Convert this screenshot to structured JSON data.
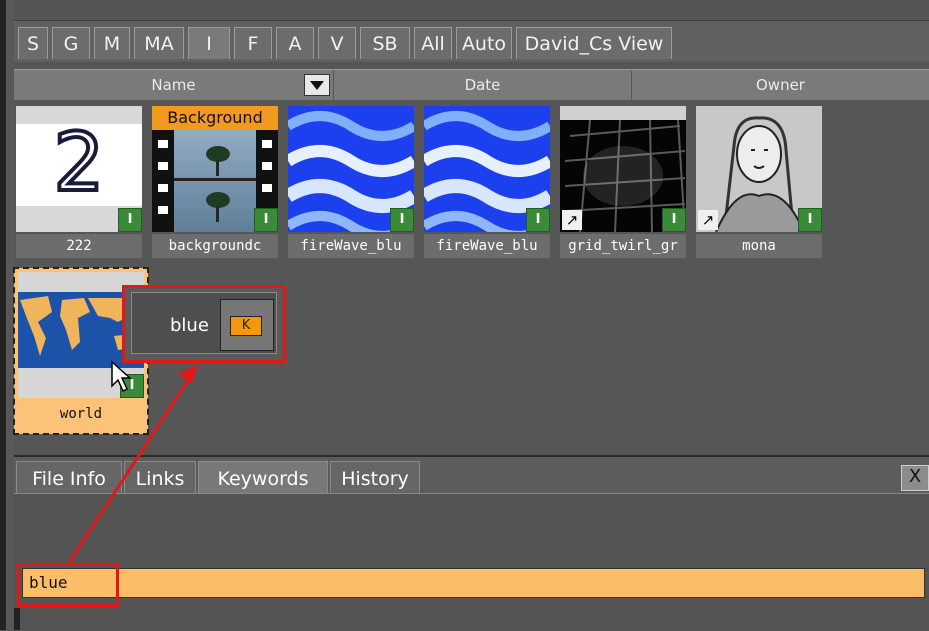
{
  "filter_tabs": [
    {
      "label": "S",
      "active": false
    },
    {
      "label": "G",
      "active": false
    },
    {
      "label": "M",
      "active": false
    },
    {
      "label": "MA",
      "active": false
    },
    {
      "label": "I",
      "active": true
    },
    {
      "label": "F",
      "active": false
    },
    {
      "label": "A",
      "active": false
    },
    {
      "label": "V",
      "active": false
    },
    {
      "label": "SB",
      "active": false
    },
    {
      "label": "All",
      "active": false
    },
    {
      "label": "Auto",
      "active": false
    },
    {
      "label": "David_Cs View",
      "active": false
    }
  ],
  "columns": {
    "name": "Name",
    "date": "Date",
    "owner": "Owner"
  },
  "items": [
    {
      "label": "222",
      "thumb_text": "2",
      "badge": "I"
    },
    {
      "label": "backgroundc",
      "tag": "Background",
      "badge": "I"
    },
    {
      "label": "fireWave_blu",
      "badge": "I"
    },
    {
      "label": "fireWave_blu",
      "badge": "I"
    },
    {
      "label": "grid_twirl_gr",
      "badge": "I",
      "link": "↗"
    },
    {
      "label": "mona",
      "badge": "I",
      "link": "↗"
    },
    {
      "label": "world",
      "badge": "I"
    }
  ],
  "keyword_tooltip": {
    "word": "blue",
    "key": "K"
  },
  "lower_tabs": [
    {
      "label": "File Info",
      "active": false
    },
    {
      "label": "Links",
      "active": false
    },
    {
      "label": "Keywords",
      "active": true
    },
    {
      "label": "History",
      "active": false
    }
  ],
  "close_label": "X",
  "keyword_field": {
    "value": "blue"
  },
  "colors": {
    "accent": "#f29a1e",
    "highlight": "#e01818",
    "field": "#fbbd68",
    "badge": "#3a8a3a"
  }
}
